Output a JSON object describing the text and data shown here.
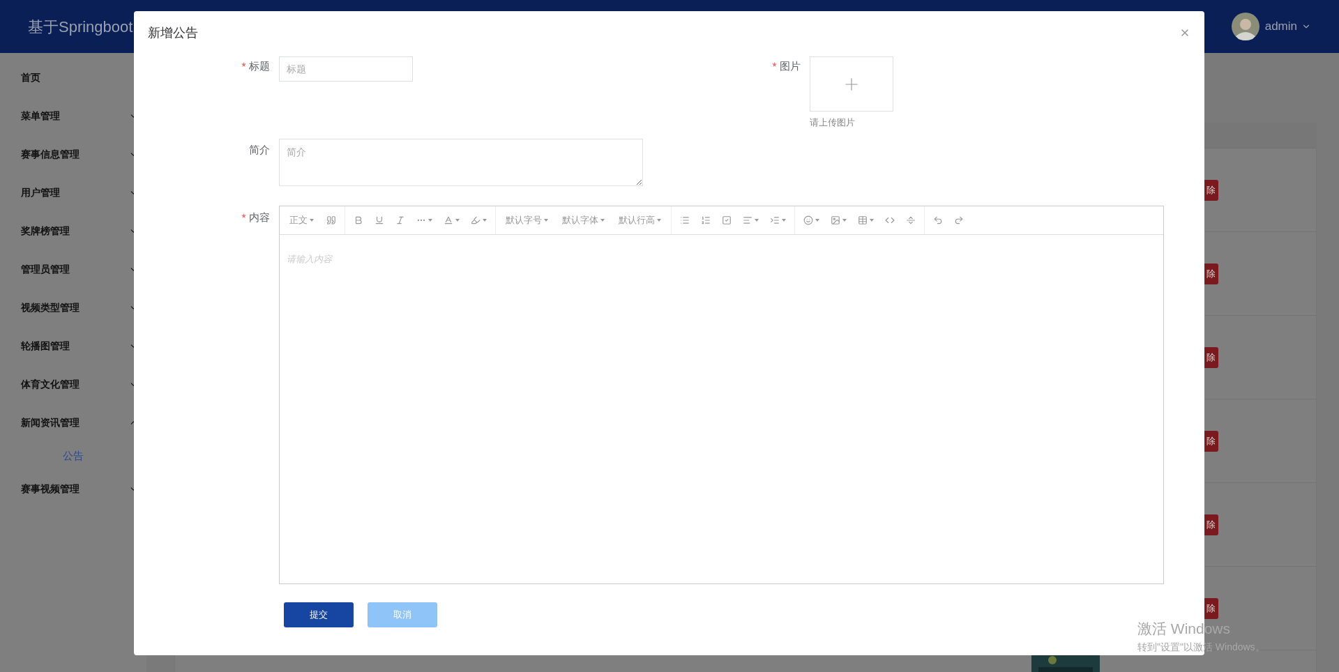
{
  "header": {
    "title": "基于Springboot",
    "user": "admin"
  },
  "sidebar": {
    "items": [
      {
        "label": "首页",
        "kind": "link"
      },
      {
        "label": "菜单管理",
        "kind": "submenu",
        "expanded": false
      },
      {
        "label": "赛事信息管理",
        "kind": "submenu",
        "expanded": false
      },
      {
        "label": "用户管理",
        "kind": "submenu",
        "expanded": false
      },
      {
        "label": "奖牌榜管理",
        "kind": "submenu",
        "expanded": false
      },
      {
        "label": "管理员管理",
        "kind": "submenu",
        "expanded": false
      },
      {
        "label": "视频类型管理",
        "kind": "submenu",
        "expanded": false
      },
      {
        "label": "轮播图管理",
        "kind": "submenu",
        "expanded": false
      },
      {
        "label": "体育文化管理",
        "kind": "submenu",
        "expanded": false
      },
      {
        "label": "新闻资讯管理",
        "kind": "submenu",
        "expanded": true,
        "children": [
          {
            "label": "公告",
            "selected": true
          }
        ]
      },
      {
        "label": "赛事视频管理",
        "kind": "submenu",
        "expanded": false
      }
    ]
  },
  "table": {
    "rows": [
      {
        "action": "除"
      },
      {
        "action": "除"
      },
      {
        "action": "除"
      },
      {
        "action": "除"
      },
      {
        "action": "除"
      },
      {
        "action": "除"
      }
    ]
  },
  "dialog": {
    "title": "新增公告",
    "fields": {
      "title": {
        "label": "标题",
        "required": true,
        "placeholder": "标题"
      },
      "image": {
        "label": "图片",
        "required": true,
        "hint": "请上传图片"
      },
      "summary": {
        "label": "简介",
        "required": false,
        "placeholder": "简介"
      },
      "content": {
        "label": "内容",
        "required": true,
        "placeholder": "请输入内容"
      }
    },
    "toolbar": {
      "paragraph_menu": "正文",
      "font_menus": [
        "默认字号",
        "默认字体",
        "默认行高"
      ]
    },
    "buttons": [
      {
        "label": "提交",
        "kind": "primary"
      },
      {
        "label": "取消",
        "kind": "secondary"
      }
    ]
  },
  "watermark": {
    "title": "激活 Windows",
    "subtitle": "转到\"设置\"以激活 Windows。"
  }
}
